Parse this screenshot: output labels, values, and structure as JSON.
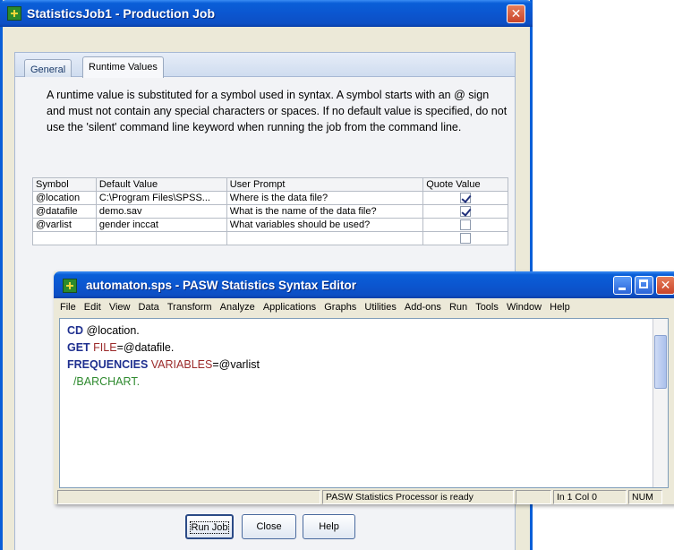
{
  "job_window": {
    "title": "StatisticsJob1 - Production Job",
    "close_label": "✕",
    "tabs": [
      {
        "label": "General",
        "active": false
      },
      {
        "label": "Runtime Values",
        "active": true
      }
    ],
    "description": "A runtime value is substituted for a symbol used in syntax. A symbol starts with an @ sign and must not contain any special characters or spaces. If no default value is specified, do not use the 'silent' command line keyword when running the job from the command line.",
    "table": {
      "headers": [
        "Symbol",
        "Default Value",
        "User Prompt",
        "Quote Value"
      ],
      "rows": [
        {
          "symbol": "@location",
          "default_value": "C:\\Program Files\\SPSS...",
          "user_prompt": "Where is the data file?",
          "quote_value": true
        },
        {
          "symbol": "@datafile",
          "default_value": "demo.sav",
          "user_prompt": "What is the name of the data file?",
          "quote_value": true
        },
        {
          "symbol": "@varlist",
          "default_value": "gender inccat",
          "user_prompt": "What variables should be used?",
          "quote_value": false
        },
        {
          "symbol": "",
          "default_value": "",
          "user_prompt": "",
          "quote_value": false
        }
      ]
    },
    "buttons": {
      "run_job": "Run Job",
      "close": "Close",
      "help": "Help"
    }
  },
  "editor_window": {
    "title": "automaton.sps - PASW Statistics Syntax Editor",
    "menu": [
      "File",
      "Edit",
      "View",
      "Data",
      "Transform",
      "Analyze",
      "Applications",
      "Graphs",
      "Utilities",
      "Add-ons",
      "Run",
      "Tools",
      "Window",
      "Help"
    ],
    "code": {
      "line1_kw": "CD",
      "line1_rest": " @location.",
      "line2_kw": "GET",
      "line2_sub": " FILE",
      "line2_rest": "=@datafile.",
      "line3_kw": "FREQUENCIES",
      "line3_sub": " VARIABLES",
      "line3_rest": "=@varlist",
      "line4": "  /BARCHART."
    },
    "status": {
      "processor": "PASW Statistics Processor is ready",
      "position": "In 1 Col 0",
      "num": "NUM"
    }
  },
  "colors": {
    "title_bar": "#0a5fd8",
    "keyword": "#1e2f8f",
    "subcommand": "#9b2a2a",
    "option": "#2e8a2e"
  },
  "icons": [
    "app-icon",
    "close-icon",
    "minimize-icon",
    "maximize-icon",
    "checkbox-checked-icon",
    "checkbox-unchecked-icon"
  ]
}
